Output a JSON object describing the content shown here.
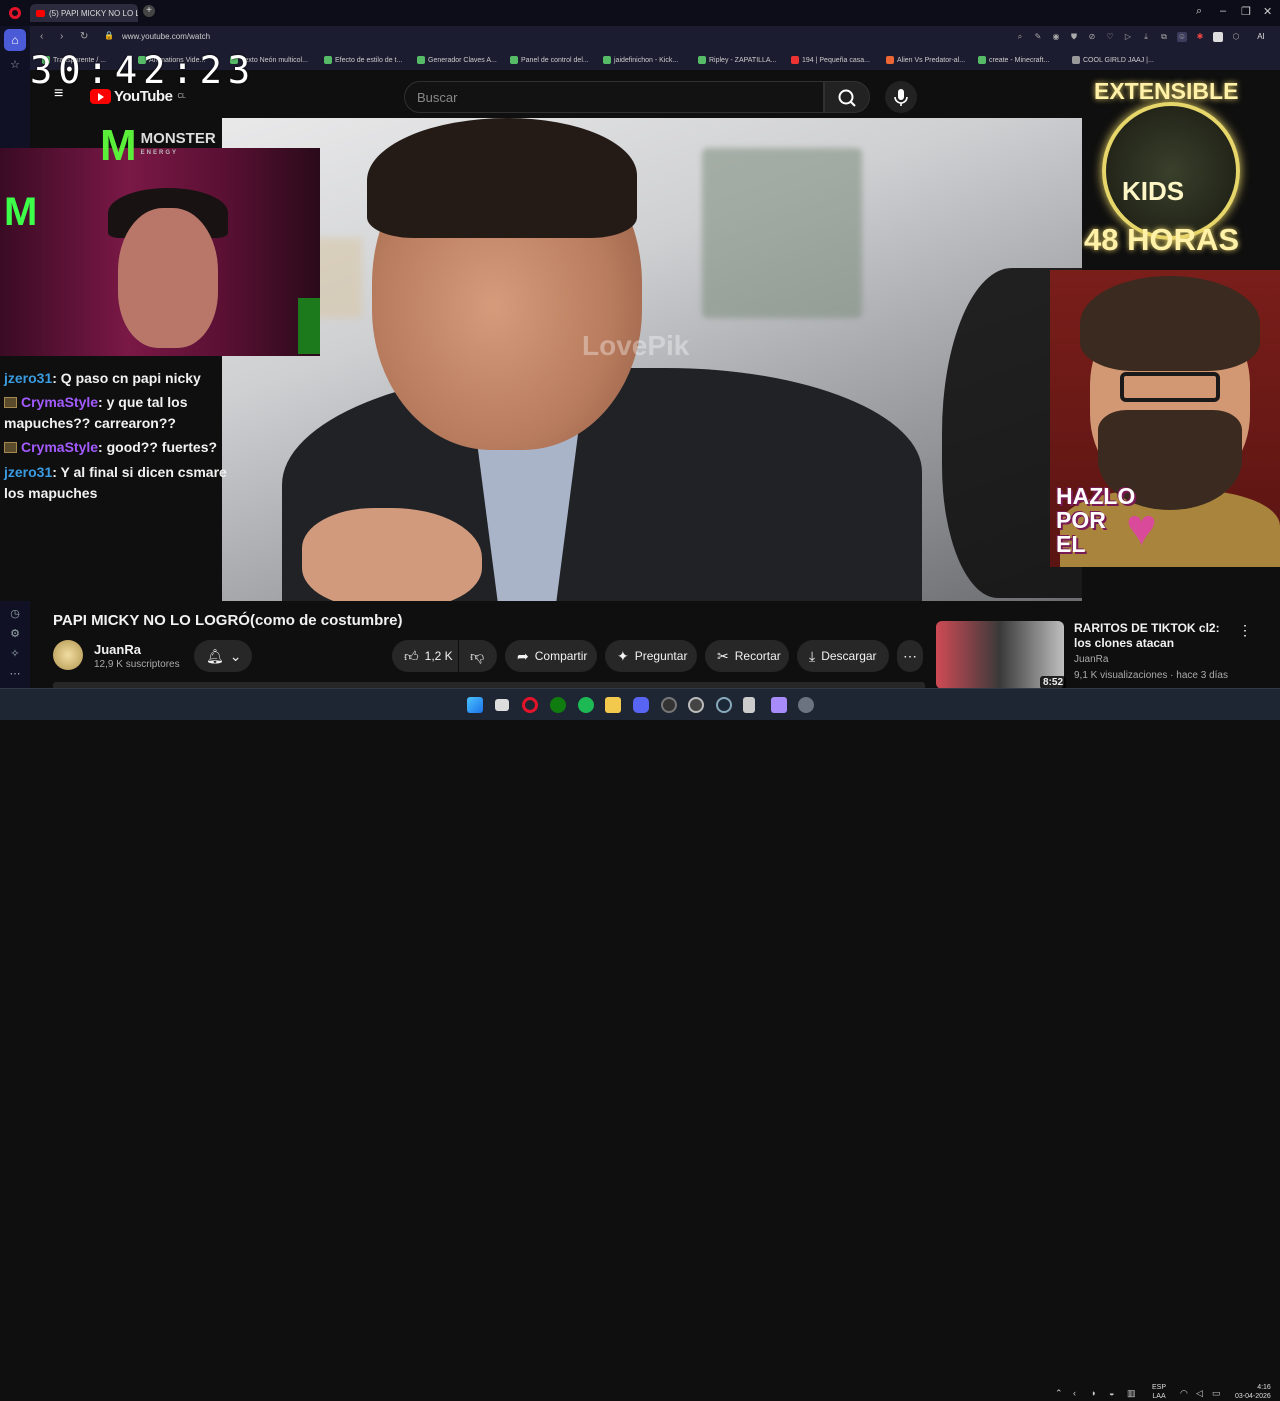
{
  "browser": {
    "tab_title": "(5) PAPI MICKY NO LO LO",
    "new_tab": "+",
    "url": "www.youtube.com/watch",
    "bookmarks": [
      "Transparente / ...",
      "Animations Vide...",
      "Texto Neón multicol...",
      "Efecto de estilo de t...",
      "Generador Claves A...",
      "Panel de control del...",
      "jaidefinichon - Kick...",
      "Ripley - ZAPATILLA...",
      "194 | Pequeña casa...",
      "Alien Vs Predator-al...",
      "create - Minecraft...",
      "COOL GIRLD JAAJ |..."
    ],
    "ai_label": "AI"
  },
  "youtube": {
    "logo_text": "YouTube",
    "country": "CL",
    "search_placeholder": "Buscar"
  },
  "overlay": {
    "timer": "30:42:23",
    "monster_brand": "MONSTER",
    "monster_sub": "ENERGY",
    "video_watermark": "LovePik",
    "extensible_title": "EXTENSIBLE",
    "extensible_kids": "KIDS",
    "extensible_hours": "48 HORAS",
    "cta": "HAZLO POR EL"
  },
  "chat": {
    "cut_line": "...",
    "messages": [
      {
        "user": "jzero31",
        "text": ": Q paso cn papi nicky"
      },
      {
        "user": "CrymaStyle",
        "text": ": y que tal los mapuches?? carrearon??"
      },
      {
        "user": "CrymaStyle",
        "text": ": good?? fuertes?"
      },
      {
        "user": "jzero31",
        "text": ": Y al final si dicen csmare los mapuches"
      }
    ]
  },
  "video_info": {
    "title": "PAPI MICKY NO LO LOGRÓ(como de costumbre)",
    "channel": "JuanRa",
    "subscribers": "12,9 K suscriptores",
    "likes": "1,2 K",
    "share": "Compartir",
    "ask": "Preguntar",
    "clip": "Recortar",
    "download": "Descargar"
  },
  "recommended": {
    "title": "RARITOS DE TIKTOK cl2: los clones atacan",
    "channel": "JuanRa",
    "meta": "9,1 K visualizaciones · hace 3 días",
    "duration": "8:52"
  },
  "taskbar": {
    "lang_top": "ESP",
    "lang_bottom": "LAA",
    "time": "4:16",
    "date": "03-04-2026"
  },
  "colors": {
    "accent": "#ff0000",
    "chat_user_blue": "#3a9be0",
    "chat_user_purple": "#a35bff",
    "overlay_gold": "#fff1a8"
  }
}
